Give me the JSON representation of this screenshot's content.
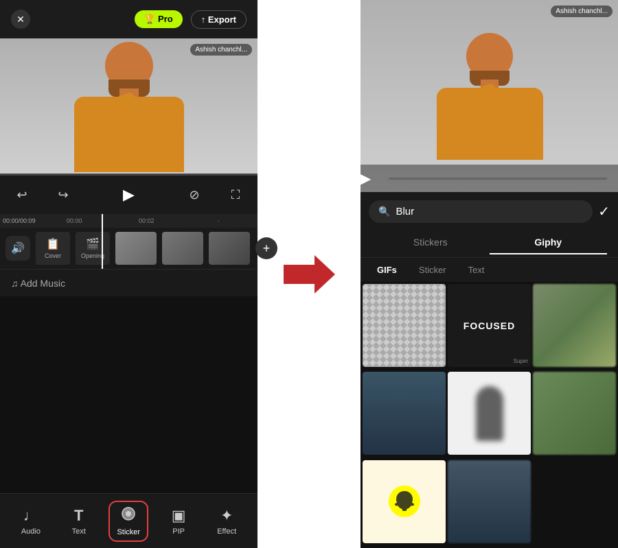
{
  "left": {
    "header": {
      "close_label": "✕",
      "pro_label": "🏆 Pro",
      "export_label": "↑ Export"
    },
    "video": {
      "author_tag": "Ashish chanchl..."
    },
    "controls": {
      "undo_icon": "↩",
      "redo_icon": "↪",
      "play_icon": "▶",
      "camera_off_icon": "⊘",
      "fullscreen_icon": "⛶"
    },
    "timeline": {
      "time_current": "00:00",
      "time_total": "00:09",
      "marks": [
        "00:00",
        "00:02"
      ],
      "cover_label": "Cover",
      "opening_label": "Opening"
    },
    "add_music_label": "♫  Add Music",
    "toolbar": {
      "items": [
        {
          "id": "audio",
          "icon": "♩",
          "label": "Audio"
        },
        {
          "id": "text",
          "icon": "T",
          "label": "Text"
        },
        {
          "id": "sticker",
          "icon": "●",
          "label": "Sticker",
          "active": true
        },
        {
          "id": "pip",
          "icon": "▣",
          "label": "PIP"
        },
        {
          "id": "effect",
          "icon": "✦",
          "label": "Effect"
        }
      ]
    }
  },
  "right": {
    "video": {
      "author_tag": "Ashish chanchl..."
    },
    "search": {
      "placeholder": "Blur",
      "value": "Blur",
      "confirm_icon": "✓"
    },
    "tabs": [
      {
        "id": "stickers",
        "label": "Stickers",
        "active": false
      },
      {
        "id": "giphy",
        "label": "Giphy",
        "active": true
      }
    ],
    "sub_tabs": [
      {
        "id": "gifs",
        "label": "GIFs",
        "active": true
      },
      {
        "id": "sticker",
        "label": "Sticker",
        "active": false
      },
      {
        "id": "text",
        "label": "Text",
        "active": false
      }
    ],
    "grid_cells": [
      {
        "id": "cell-1",
        "type": "checkered"
      },
      {
        "id": "cell-2",
        "type": "focused"
      },
      {
        "id": "cell-3",
        "type": "outdoor"
      },
      {
        "id": "cell-4",
        "type": "scene"
      },
      {
        "id": "cell-5",
        "type": "white-blur"
      },
      {
        "id": "cell-6",
        "type": "outdoor2"
      },
      {
        "id": "cell-7",
        "type": "snapchat"
      },
      {
        "id": "cell-8",
        "type": "scene2"
      }
    ]
  },
  "arrow": {
    "label": "→"
  }
}
